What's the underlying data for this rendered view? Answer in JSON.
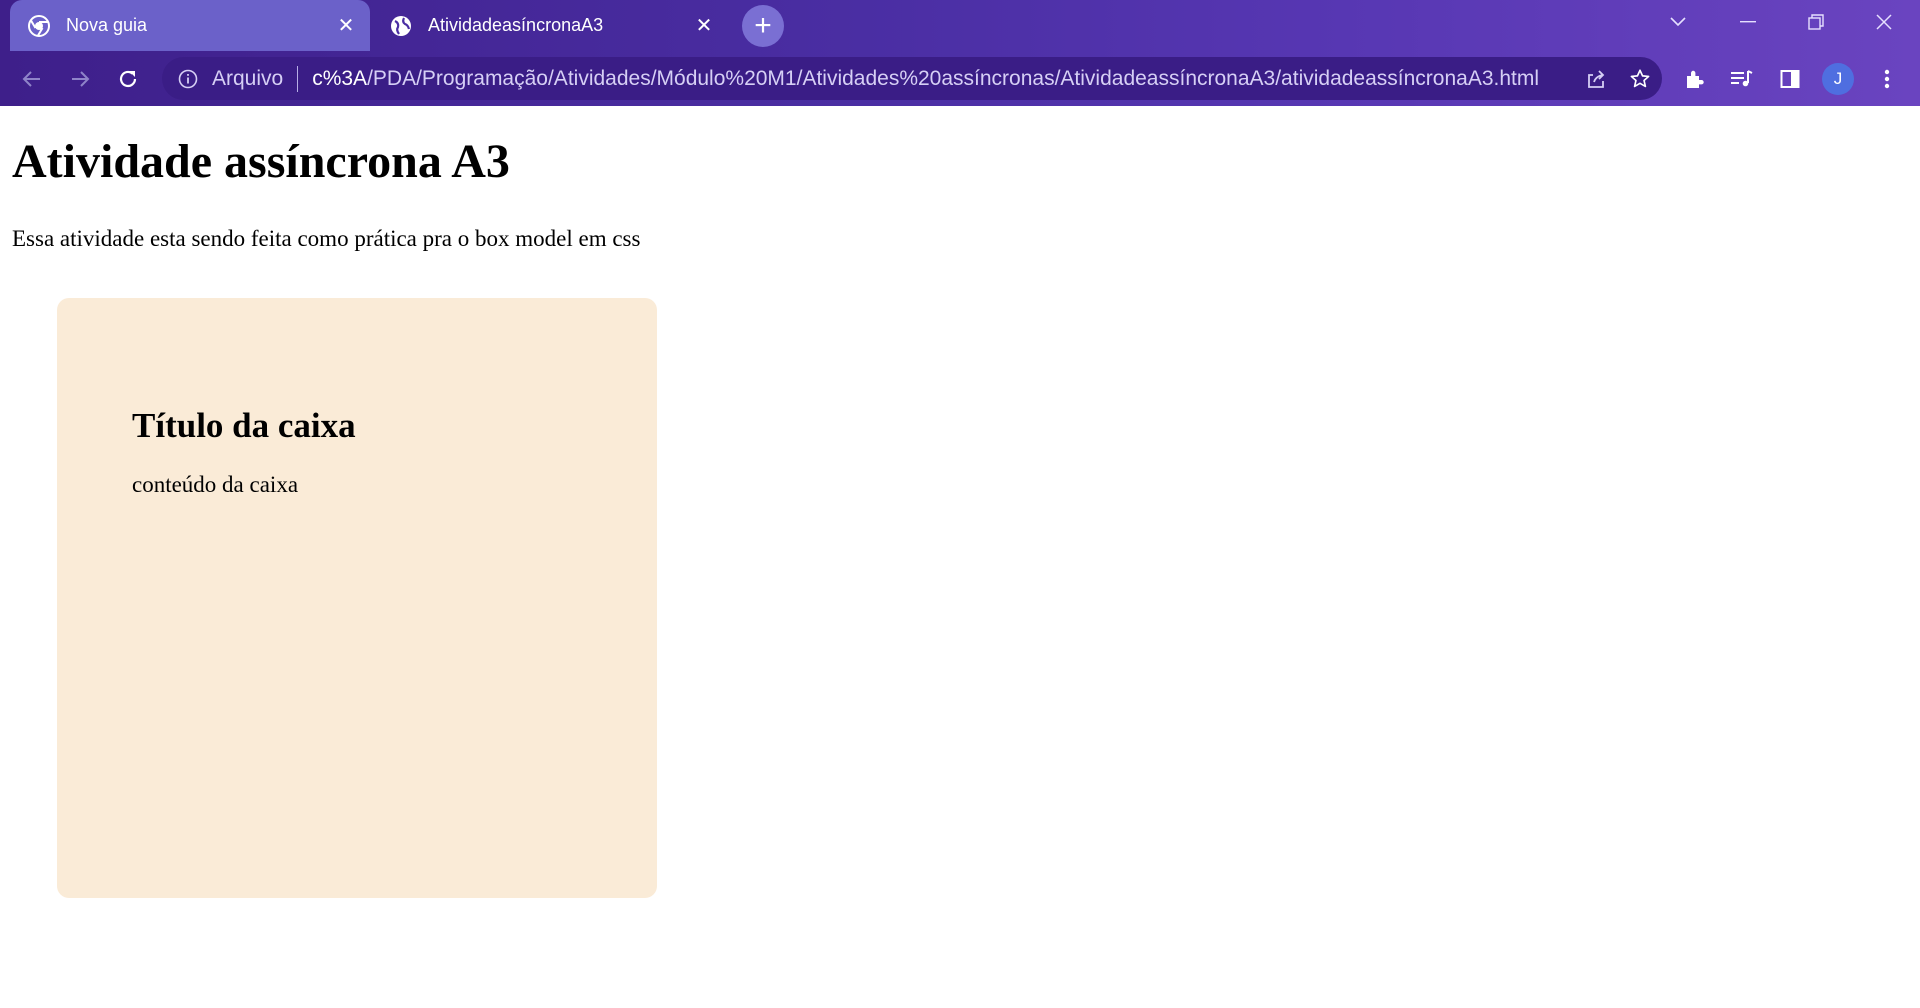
{
  "browser": {
    "tabs": [
      {
        "title": "Nova guia",
        "icon": "chrome-icon",
        "active": false
      },
      {
        "title": "AtividadeasíncronaA3",
        "icon": "globe-icon",
        "active": true
      }
    ],
    "new_tab_label": "+",
    "address_bar": {
      "scheme_label": "Arquivo",
      "url_host": "c%3A",
      "url_path": "/PDA/Programação/Atividades/Módulo%20M1/Atividades%20assíncronas/AtividadeassíncronaA3/atividadeassíncronaA3.html"
    },
    "profile_initial": "J",
    "colors": {
      "frame": "#4a2ea3",
      "inactive_tab": "#6b61c9",
      "omnibox": "#3a1d86"
    }
  },
  "page": {
    "heading": "Atividade assíncrona A3",
    "intro": "Essa atividade esta sendo feita como prática pra o box model em css",
    "box": {
      "title": "Título da caixa",
      "content": "conteúdo da caixa",
      "background": "#faebd7"
    }
  }
}
